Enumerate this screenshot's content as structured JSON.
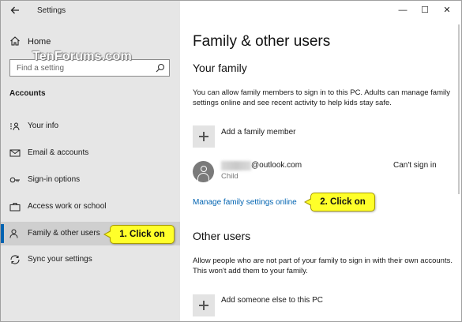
{
  "window": {
    "app_title": "Settings",
    "back_icon": "arrow-left-icon",
    "controls": {
      "minimize": "—",
      "maximize": "☐",
      "close": "✕"
    }
  },
  "watermark": "TenForums.com",
  "sidebar": {
    "home_label": "Home",
    "search_placeholder": "Find a setting",
    "section_label": "Accounts",
    "items": [
      {
        "label": "Your info",
        "icon": "id-card-icon"
      },
      {
        "label": "Email & accounts",
        "icon": "mail-icon"
      },
      {
        "label": "Sign-in options",
        "icon": "key-icon"
      },
      {
        "label": "Access work or school",
        "icon": "briefcase-icon"
      },
      {
        "label": "Family & other users",
        "icon": "person-add-icon",
        "selected": true
      },
      {
        "label": "Sync your settings",
        "icon": "sync-icon"
      }
    ]
  },
  "callouts": {
    "step1": "1. Click on",
    "step2": "2. Click on"
  },
  "main": {
    "title": "Family & other users",
    "your_family": {
      "heading": "Your family",
      "description": "You can allow family members to sign in to this PC. Adults can manage family settings online and see recent activity to help kids stay safe.",
      "add_member_label": "Add a family member",
      "member": {
        "email": "@outlook.com",
        "role": "Child",
        "status": "Can't sign in"
      },
      "manage_link": "Manage family settings online"
    },
    "other_users": {
      "heading": "Other users",
      "description": "Allow people who are not part of your family to sign in with their own accounts. This won't add them to your family.",
      "add_label": "Add someone else to this PC"
    }
  },
  "colors": {
    "accent": "#0063b1",
    "sidebar_bg": "#e6e6e6",
    "callout_bg": "#ffff2a"
  }
}
